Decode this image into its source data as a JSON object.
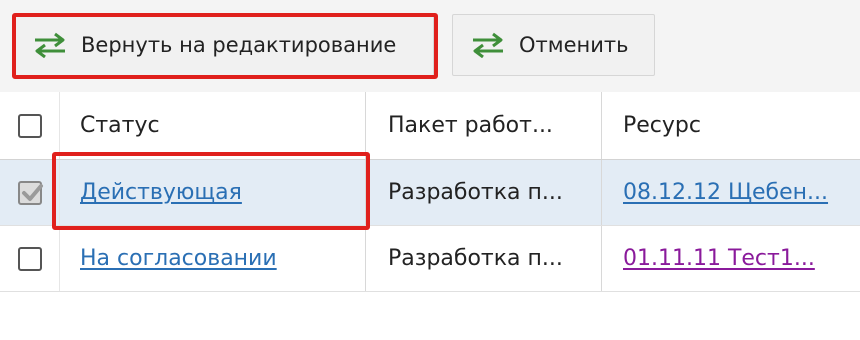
{
  "toolbar": {
    "return_label": "Вернуть на редактирование",
    "cancel_label": "Отменить"
  },
  "table": {
    "columns": [
      "Статус",
      "Пакет работ...",
      "Ресурс"
    ],
    "rows": [
      {
        "checked": true,
        "status": "Действующая",
        "package": "Разработка п...",
        "resource": "08.12.12 Щебен..."
      },
      {
        "checked": false,
        "status": "На согласовании",
        "package": "Разработка п...",
        "resource": "01.11.11 Тест1..."
      }
    ]
  },
  "colors": {
    "link": "#2a6fb4",
    "visited_link": "#8a1a9b",
    "highlight": "#e0201c",
    "selected_row": "#e3ecf5",
    "arrow_icon": "#3f8f3a"
  },
  "icons": {
    "swap": "swap-arrows-icon",
    "check": "checkmark-icon"
  }
}
